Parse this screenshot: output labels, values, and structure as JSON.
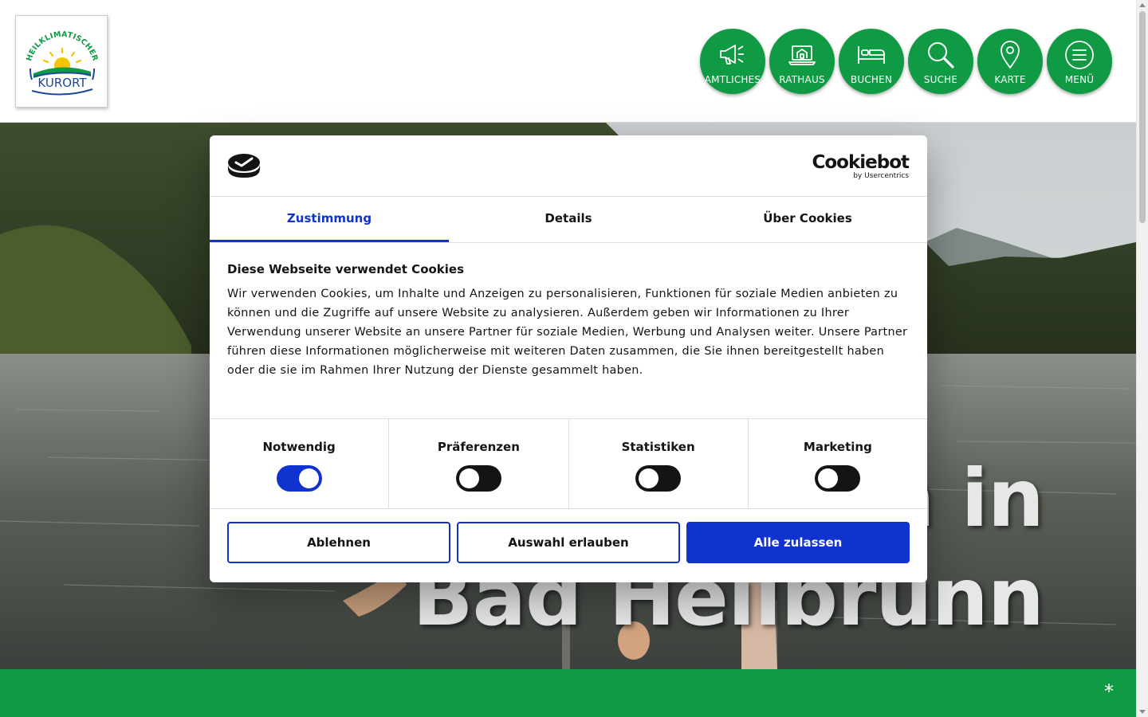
{
  "header": {
    "logo": {
      "arc_text": "HEILKLIMATISCHER",
      "main_text": "KURORT",
      "colors": {
        "green": "#109a43",
        "blue": "#1d4a9b",
        "sun": "#f5c400"
      }
    },
    "nav": [
      {
        "label": "AMTLICHES",
        "icon": "megaphone-icon"
      },
      {
        "label": "RATHAUS",
        "icon": "laptop-house-icon"
      },
      {
        "label": "BUCHEN",
        "icon": "bed-icon"
      },
      {
        "label": "SUCHE",
        "icon": "search-icon"
      },
      {
        "label": "KARTE",
        "icon": "map-pin-icon"
      },
      {
        "label": "MENÜ",
        "icon": "menu-icon"
      }
    ],
    "nav_color": "#109a43"
  },
  "hero": {
    "title_line1": "n in",
    "title_line2": "Bad Heilbrunn"
  },
  "footer_bar": {
    "asterisk": "*",
    "color": "#109a43"
  },
  "cookie_dialog": {
    "brand": "Cookiebot",
    "brand_sub": "by Usercentrics",
    "tabs": [
      {
        "label": "Zustimmung",
        "active": true
      },
      {
        "label": "Details",
        "active": false
      },
      {
        "label": "Über Cookies",
        "active": false
      }
    ],
    "title": "Diese Webseite verwendet Cookies",
    "text": "Wir verwenden Cookies, um Inhalte und Anzeigen zu personalisieren, Funktionen für soziale Medien anbieten zu können und die Zugriffe auf unsere Website zu analysieren. Außerdem geben wir Informationen zu Ihrer Verwendung unserer Website an unsere Partner für soziale Medien, Werbung und Analysen weiter. Unsere Partner führen diese Informationen möglicherweise mit weiteren Daten zusammen, die Sie ihnen bereitgestellt haben oder die sie im Rahmen Ihrer Nutzung der Dienste gesammelt haben.",
    "categories": [
      {
        "label": "Notwendig",
        "enabled": true
      },
      {
        "label": "Präferenzen",
        "enabled": false
      },
      {
        "label": "Statistiken",
        "enabled": false
      },
      {
        "label": "Marketing",
        "enabled": false
      }
    ],
    "buttons": {
      "decline": "Ablehnen",
      "allow_selection": "Auswahl erlauben",
      "allow_all": "Alle zulassen"
    },
    "accent_color": "#1032cf"
  }
}
